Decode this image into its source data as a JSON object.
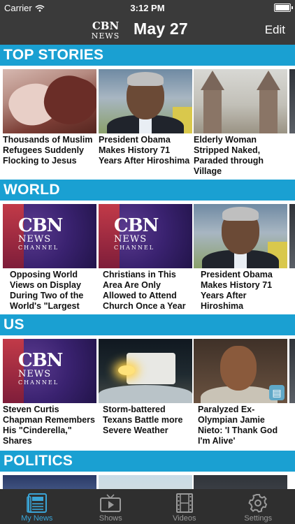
{
  "status_bar": {
    "carrier": "Carrier",
    "time": "3:12 PM"
  },
  "header": {
    "logo_text_top": "CBN",
    "logo_text_bottom": "NEWS",
    "title": "May 27",
    "edit_label": "Edit"
  },
  "sections": [
    {
      "title": "TOP STORIES",
      "cards": [
        {
          "headline": "Thousands of Muslim Refugees Suddenly Flocking to Jesus",
          "thumb": "hands-photo"
        },
        {
          "headline": "President Obama Makes History 71 Years After Hiroshima",
          "thumb": "portrait-photo"
        },
        {
          "headline": "Elderly Woman Stripped Naked, Paraded through Village",
          "thumb": "towers-photo"
        }
      ]
    },
    {
      "title": "WORLD",
      "cards": [
        {
          "headline": "Opposing World Views on Display During Two of the World's \"Largest",
          "thumb": "cbn-news-channel"
        },
        {
          "headline": "Christians in This Area Are Only Allowed to Attend Church Once a Year",
          "thumb": "cbn-news-channel"
        },
        {
          "headline": "President Obama Makes History 71 Years After Hiroshima",
          "thumb": "portrait-photo"
        }
      ]
    },
    {
      "title": "US",
      "cards": [
        {
          "headline": "Steven Curtis Chapman Remembers His \"Cinderella,\" Shares",
          "thumb": "cbn-news-channel"
        },
        {
          "headline": "Storm-battered Texans Battle more Severe Weather",
          "thumb": "flood-photo"
        },
        {
          "headline": "Paralyzed Ex-Olympian Jamie Nieto: 'I Thank God I'm Alive'",
          "thumb": "man-photo"
        }
      ]
    },
    {
      "title": "POLITICS",
      "cards": [
        {
          "headline": "",
          "thumb": "crowd-photo"
        },
        {
          "headline": "",
          "thumb": "light-photo"
        },
        {
          "headline": "",
          "thumb": "dark-photo"
        }
      ]
    }
  ],
  "thumb_brand": {
    "big": "CBN",
    "small": "NEWS",
    "channel": "CHANNEL"
  },
  "tab_bar": {
    "active_color": "#3aa4d6",
    "tabs": [
      {
        "label": "My News",
        "icon": "newspaper-icon"
      },
      {
        "label": "Shows",
        "icon": "tv-icon"
      },
      {
        "label": "Videos",
        "icon": "film-icon"
      },
      {
        "label": "Settings",
        "icon": "gear-icon"
      }
    ]
  },
  "colors": {
    "section_header": "#1aa0d2",
    "bar_background": "#3a3a3a"
  }
}
